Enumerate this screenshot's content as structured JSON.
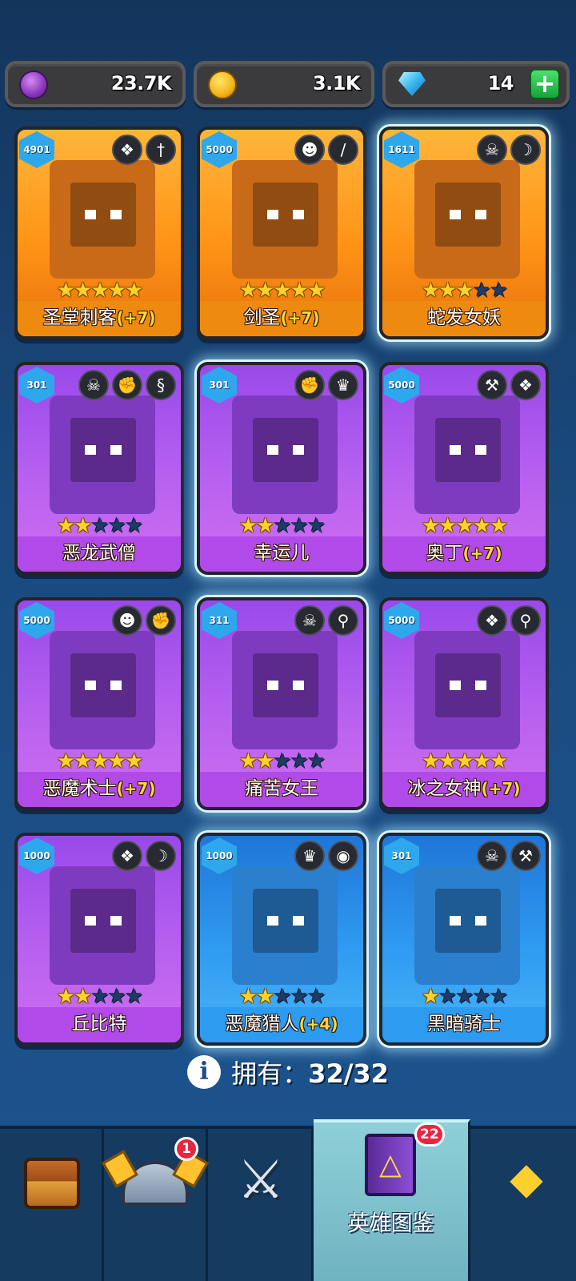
{
  "resources": {
    "purple_coin": {
      "value": "23.7K",
      "icon": "purple-coin-icon",
      "color": "#a14bd6"
    },
    "gold_coin": {
      "value": "3.1K",
      "icon": "gold-coin-icon",
      "color": "#f2b418"
    },
    "gems": {
      "value": "14",
      "icon": "gem-icon",
      "color": "#37b8ef",
      "plus_label": "+"
    }
  },
  "heroes": [
    {
      "name": "圣堂刺客",
      "bonus": "(+7)",
      "level": "4901",
      "stars": 5,
      "rarity": "orange",
      "badges": [
        "wing-emblem-icon",
        "dagger-icon"
      ]
    },
    {
      "name": "剑圣",
      "bonus": "(+7)",
      "level": "5000",
      "stars": 5,
      "rarity": "orange",
      "badges": [
        "skull-mask-icon",
        "sword-icon"
      ]
    },
    {
      "name": "蛇发女妖",
      "bonus": "",
      "level": "1611",
      "stars": 3,
      "rarity": "orange",
      "badges": [
        "demon-skull-icon",
        "bow-icon"
      ]
    },
    {
      "name": "恶龙武僧",
      "bonus": "",
      "level": "301",
      "stars": 2,
      "rarity": "purple",
      "badges": [
        "demon-skull-icon",
        "fist-icon",
        "dragon-icon"
      ]
    },
    {
      "name": "幸运儿",
      "bonus": "",
      "level": "301",
      "stars": 2,
      "rarity": "purple",
      "badges": [
        "fist-icon",
        "elf-icon"
      ]
    },
    {
      "name": "奥丁",
      "bonus": "(+7)",
      "level": "5000",
      "stars": 5,
      "rarity": "purple",
      "badges": [
        "hammer-icon",
        "wing-emblem-icon"
      ]
    },
    {
      "name": "恶魔术士",
      "bonus": "(+7)",
      "level": "5000",
      "stars": 5,
      "rarity": "purple",
      "badges": [
        "skull-mask-icon",
        "fist-icon"
      ]
    },
    {
      "name": "痛苦女王",
      "bonus": "",
      "level": "311",
      "stars": 2,
      "rarity": "purple",
      "badges": [
        "demon-skull-icon",
        "staff-icon"
      ]
    },
    {
      "name": "冰之女神",
      "bonus": "(+7)",
      "level": "5000",
      "stars": 5,
      "rarity": "purple",
      "badges": [
        "wing-emblem-icon",
        "staff-icon"
      ]
    },
    {
      "name": "丘比特",
      "bonus": "",
      "level": "1000",
      "stars": 2,
      "rarity": "purple",
      "badges": [
        "wing-emblem-icon",
        "bow-icon"
      ]
    },
    {
      "name": "恶魔猎人",
      "bonus": "(+4)",
      "level": "1000",
      "stars": 2,
      "rarity": "blue",
      "badges": [
        "elf-icon",
        "eye-icon"
      ]
    },
    {
      "name": "黑暗骑士",
      "bonus": "",
      "level": "301",
      "stars": 1,
      "rarity": "blue",
      "badges": [
        "demon-skull-icon",
        "hammer-icon"
      ]
    }
  ],
  "owned": {
    "label": "拥有：",
    "count": "32/32",
    "icon": "info-icon"
  },
  "nav": [
    {
      "id": "chest",
      "icon": "treasure-chest-icon",
      "label": "",
      "badge": ""
    },
    {
      "id": "heroes",
      "icon": "viking-helmet-icon",
      "label": "",
      "badge": "1"
    },
    {
      "id": "battle",
      "icon": "crossed-swords-icon",
      "label": "",
      "badge": ""
    },
    {
      "id": "codex",
      "icon": "spell-book-icon",
      "label": "英雄图鉴",
      "badge": "22",
      "active": true
    },
    {
      "id": "items",
      "icon": "amulet-icon",
      "label": "",
      "badge": ""
    }
  ]
}
